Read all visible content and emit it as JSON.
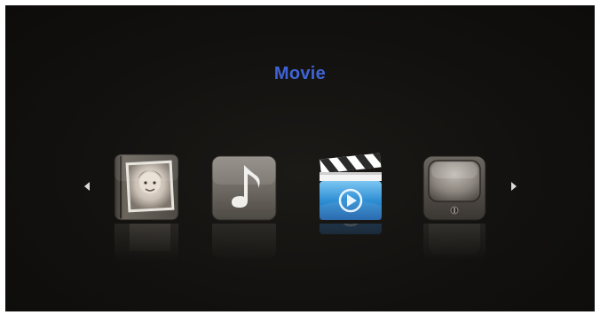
{
  "menu": {
    "title": "Movie",
    "items": [
      {
        "icon": "photo-icon"
      },
      {
        "icon": "music-icon"
      },
      {
        "icon": "movie-icon",
        "selected": true
      },
      {
        "icon": "tv-icon"
      }
    ]
  },
  "colors": {
    "title": "#3f63d6",
    "background": "#12110f",
    "arrow": "#d9d9d9"
  }
}
